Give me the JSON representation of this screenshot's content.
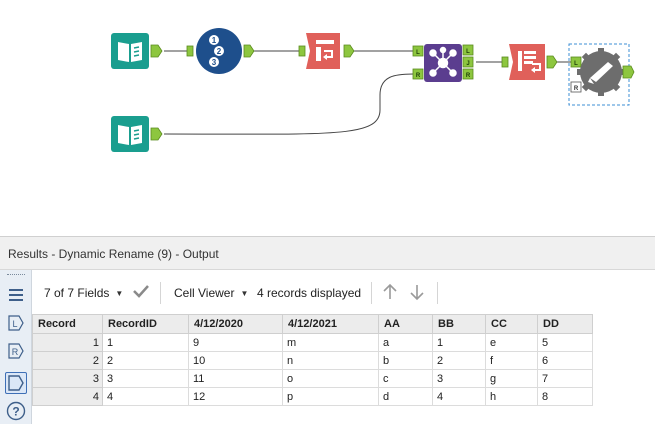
{
  "results": {
    "title": "Results - Dynamic Rename (9) - Output",
    "field_selector": "7 of 7 Fields",
    "viewer_selector": "Cell Viewer",
    "records_status": "4 records displayed"
  },
  "icons": {
    "input_data": "book-icon",
    "record_id": "numbered-list-icon",
    "cross_tab": "table-arrow-icon",
    "join": "join-icon",
    "dynamic_rename": "rename-icon",
    "browse": "gear-icon"
  },
  "anchors": {
    "left": "L",
    "right": "R",
    "join": "J"
  },
  "table": {
    "columns": [
      "Record",
      "RecordID",
      "4/12/2020",
      "4/12/2021",
      "AA",
      "BB",
      "CC",
      "DD"
    ],
    "rows": [
      [
        "1",
        "1",
        "9",
        "m",
        "a",
        "1",
        "e",
        "5"
      ],
      [
        "2",
        "2",
        "10",
        "n",
        "b",
        "2",
        "f",
        "6"
      ],
      [
        "3",
        "3",
        "11",
        "o",
        "c",
        "3",
        "g",
        "7"
      ],
      [
        "4",
        "4",
        "12",
        "p",
        "d",
        "4",
        "h",
        "8"
      ]
    ]
  },
  "colors": {
    "input_teal": "#1a9e8f",
    "record_id_navy": "#1e4f8c",
    "transform_red": "#e0605a",
    "join_purple": "#5b3d8f",
    "browse_gray": "#6d6d6d",
    "anchor_green": "#8dc63f",
    "selection_blue": "#3e8fd6"
  }
}
